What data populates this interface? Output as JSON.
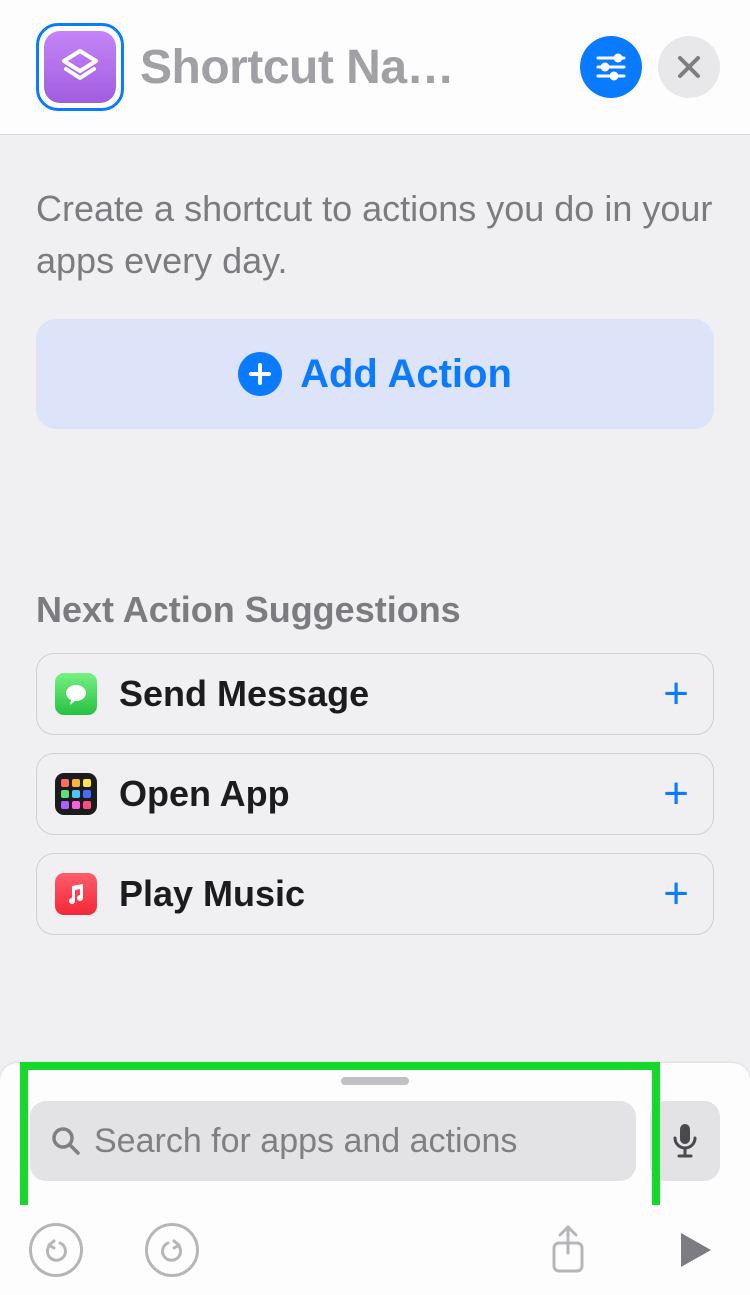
{
  "header": {
    "title": "Shortcut Na…"
  },
  "intro_text": "Create a shortcut to actions you do in your apps every day.",
  "add_action_label": "Add Action",
  "suggestions_heading": "Next Action Suggestions",
  "suggestions": [
    {
      "label": "Send Message",
      "icon": "messages-icon"
    },
    {
      "label": "Open App",
      "icon": "app-grid-icon"
    },
    {
      "label": "Play Music",
      "icon": "music-icon"
    }
  ],
  "search": {
    "placeholder": "Search for apps and actions"
  },
  "colors": {
    "accent": "#0a7aff",
    "highlight": "#15d82a"
  }
}
